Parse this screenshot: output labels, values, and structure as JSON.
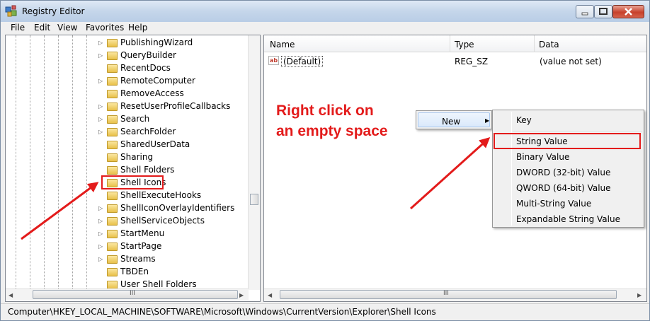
{
  "window": {
    "title": "Registry Editor",
    "icon": "registry-editor-icon",
    "controls": [
      "minimize-icon",
      "maximize-icon",
      "close-icon"
    ]
  },
  "menu": [
    "File",
    "Edit",
    "View",
    "Favorites",
    "Help"
  ],
  "tree": {
    "items": [
      {
        "label": "PublishingWizard",
        "expandable": true
      },
      {
        "label": "QueryBuilder",
        "expandable": true
      },
      {
        "label": "RecentDocs",
        "expandable": false
      },
      {
        "label": "RemoteComputer",
        "expandable": true
      },
      {
        "label": "RemoveAccess",
        "expandable": false
      },
      {
        "label": "ResetUserProfileCallbacks",
        "expandable": true
      },
      {
        "label": "Search",
        "expandable": true
      },
      {
        "label": "SearchFolder",
        "expandable": true
      },
      {
        "label": "SharedUserData",
        "expandable": false
      },
      {
        "label": "Sharing",
        "expandable": false
      },
      {
        "label": "Shell Folders",
        "expandable": false
      },
      {
        "label": "Shell Icons",
        "expandable": false,
        "highlighted": true
      },
      {
        "label": "ShellExecuteHooks",
        "expandable": false
      },
      {
        "label": "ShellIconOverlayIdentifiers",
        "expandable": true
      },
      {
        "label": "ShellServiceObjects",
        "expandable": true
      },
      {
        "label": "StartMenu",
        "expandable": true
      },
      {
        "label": "StartPage",
        "expandable": true
      },
      {
        "label": "Streams",
        "expandable": true
      },
      {
        "label": "TBDEn",
        "expandable": false
      },
      {
        "label": "User Shell Folders",
        "expandable": false
      }
    ],
    "hscroll_grip": "III"
  },
  "list": {
    "columns": [
      "Name",
      "Type",
      "Data"
    ],
    "rows": [
      {
        "name": "(Default)",
        "type": "REG_SZ",
        "data": "(value not set)",
        "icon": "string-value-ab-icon"
      }
    ],
    "hscroll_grip": "III"
  },
  "annotation": {
    "line1": "Right click on",
    "line2": "an empty space",
    "color": "#e31b1b"
  },
  "context_menu": {
    "new_label": "New",
    "submenu": [
      "Key",
      "String Value",
      "Binary Value",
      "DWORD (32-bit) Value",
      "QWORD (64-bit) Value",
      "Multi-String Value",
      "Expandable String Value"
    ]
  },
  "status": {
    "path": "Computer\\HKEY_LOCAL_MACHINE\\SOFTWARE\\Microsoft\\Windows\\CurrentVersion\\Explorer\\Shell Icons"
  }
}
